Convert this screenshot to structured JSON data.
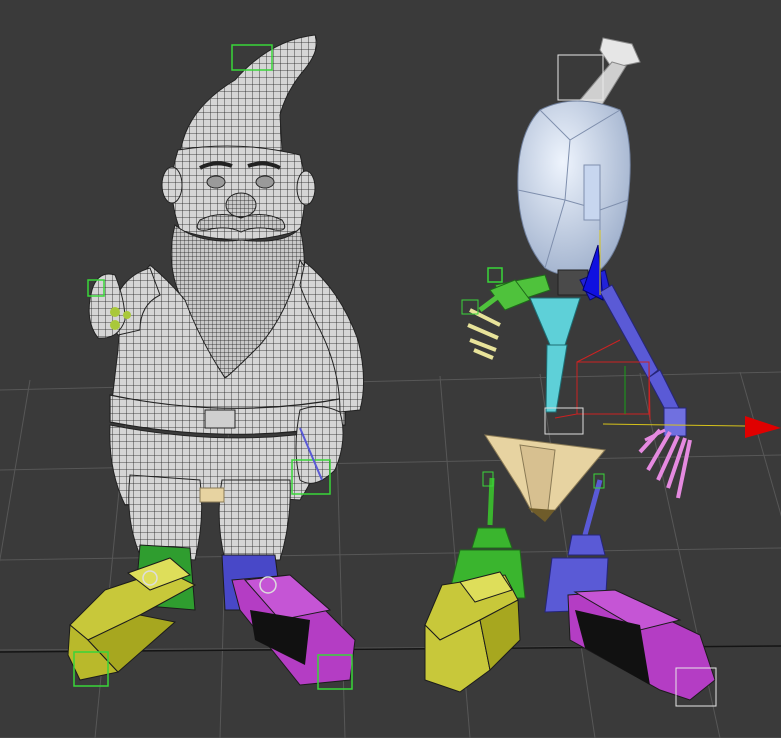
{
  "viewport": {
    "label": "",
    "background": "#3a3a3a",
    "grid_color": "#5a5a5a",
    "grid_axis_color": "#141414"
  },
  "objects": {
    "gnome_mesh": {
      "name": "",
      "wire_color": "#151515",
      "fill_color": "#d9d9d9"
    },
    "biped_rig": {
      "name": "",
      "head_color": "#d4e3f8",
      "spine_color": "#5ed0d8",
      "pelvis_color": "#e7d3a1",
      "left_arm_color": "#4fc23c",
      "right_arm_color": "#5a5ad6",
      "left_leg_color": "#3ab52e",
      "right_leg_color": "#5a5ad6",
      "left_foot_color": "#c8c83a",
      "right_foot_color": "#b43dc4",
      "left_hand_color": "#e8e39a",
      "right_hand_color": "#e58ae0"
    }
  },
  "gizmo": {
    "x_color": "#e00000",
    "y_color": "#00c000",
    "z_color": "#1818e8"
  }
}
